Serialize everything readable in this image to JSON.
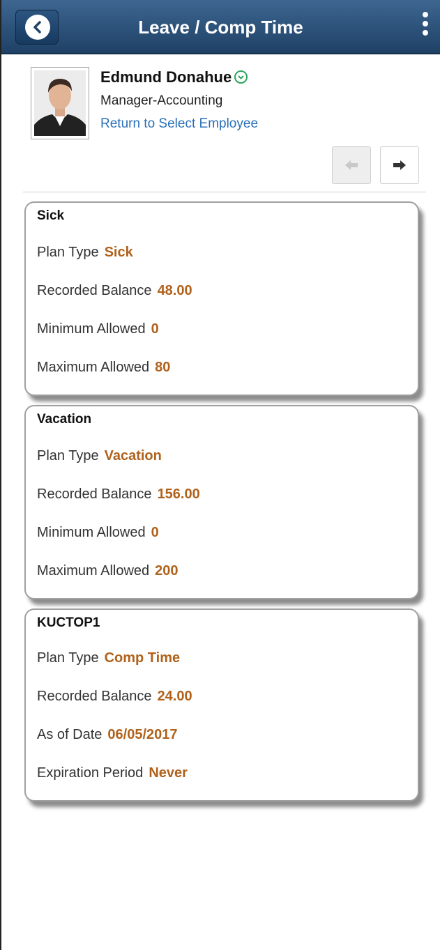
{
  "header": {
    "title": "Leave / Comp Time"
  },
  "employee": {
    "name": "Edmund Donahue",
    "title": "Manager-Accounting",
    "return_link": "Return to Select Employee"
  },
  "cards": [
    {
      "title": "Sick",
      "rows": [
        {
          "label": "Plan Type",
          "value": "Sick"
        },
        {
          "label": "Recorded Balance",
          "value": "48.00"
        },
        {
          "label": "Minimum Allowed",
          "value": "0"
        },
        {
          "label": "Maximum Allowed",
          "value": "80"
        }
      ]
    },
    {
      "title": "Vacation",
      "rows": [
        {
          "label": "Plan Type",
          "value": "Vacation"
        },
        {
          "label": "Recorded Balance",
          "value": "156.00"
        },
        {
          "label": "Minimum Allowed",
          "value": "0"
        },
        {
          "label": "Maximum Allowed",
          "value": "200"
        }
      ]
    },
    {
      "title": "KUCTOP1",
      "rows": [
        {
          "label": "Plan Type",
          "value": "Comp Time"
        },
        {
          "label": "Recorded Balance",
          "value": "24.00"
        },
        {
          "label": "As of Date",
          "value": "06/05/2017"
        },
        {
          "label": "Expiration Period",
          "value": "Never"
        }
      ]
    }
  ],
  "colors": {
    "header": "#2a5178",
    "value": "#b0621c",
    "link": "#2a6fb9",
    "accent_green": "#2aa55a"
  }
}
